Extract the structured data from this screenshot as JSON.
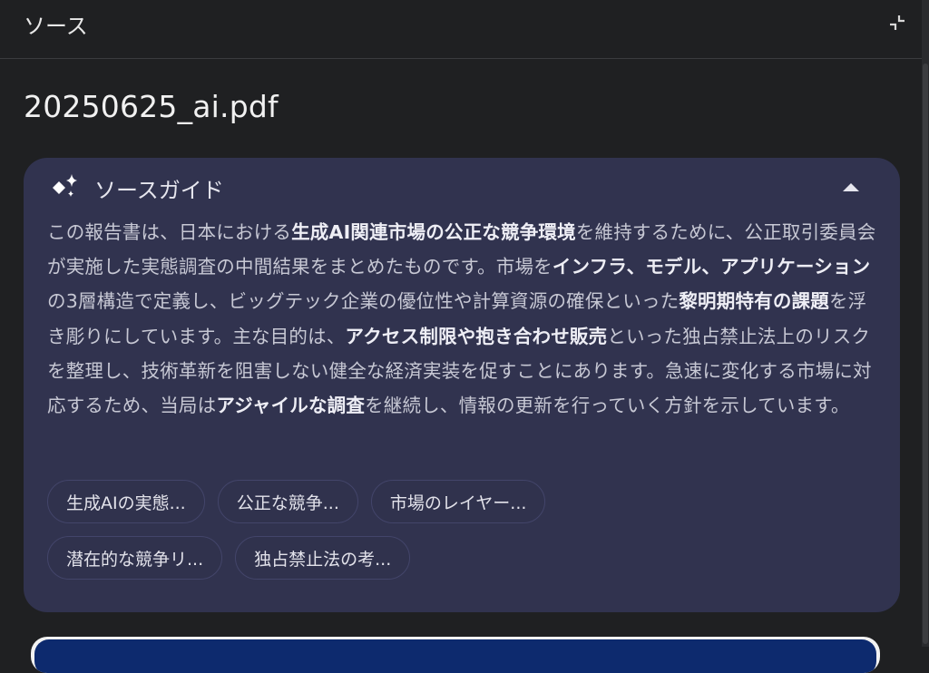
{
  "panel": {
    "title": "ソース",
    "collapse_icon": "collapse-icon"
  },
  "document": {
    "title": "20250625_ai.pdf"
  },
  "source_guide": {
    "title": "ソースガイド",
    "icon": "sparkle-icon",
    "toggle_icon": "chevron-up-icon",
    "summary_segments": [
      {
        "text": "この報告書は、日本における",
        "bold": false
      },
      {
        "text": "生成AI関連市場の公正な競争環境",
        "bold": true
      },
      {
        "text": "を維持するために、公正取引委員会が実施した実態調査の中間結果をまとめたものです。市場を",
        "bold": false
      },
      {
        "text": "インフラ、モデル、アプリケーション",
        "bold": true
      },
      {
        "text": "の3層構造で定義し、ビッグテック企業の優位性や計算資源の確保といった",
        "bold": false
      },
      {
        "text": "黎明期特有の課題",
        "bold": true
      },
      {
        "text": "を浮き彫りにしています。主な目的は、",
        "bold": false
      },
      {
        "text": "アクセス制限や抱き合わせ販売",
        "bold": true
      },
      {
        "text": "といった独占禁止法上のリスクを整理し、技術革新を阻害しない健全な経済実装を促すことにあります。急速に変化する市場に対応するため、当局は",
        "bold": false
      },
      {
        "text": "アジャイルな調査",
        "bold": true
      },
      {
        "text": "を継続し、情報の更新を行っていく方針を示しています。",
        "bold": false
      }
    ],
    "topics": [
      [
        "生成AIの実態...",
        "公正な競争...",
        "市場のレイヤー..."
      ],
      [
        "潜在的な競争リ...",
        "独占禁止法の考..."
      ]
    ]
  },
  "colors": {
    "background": "#1f2022",
    "card": "#31334f",
    "chip_border": "#43456a"
  }
}
